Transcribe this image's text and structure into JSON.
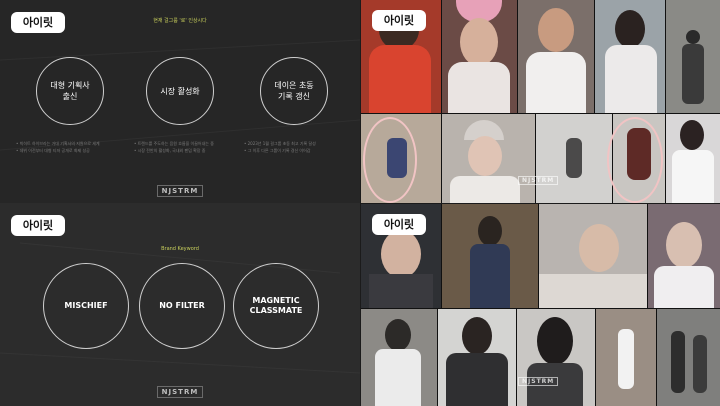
{
  "brand_logo": "아이릿",
  "watermark": "NJSTRM",
  "slide1": {
    "header": "현재 걸그룹 '로' 인상시다",
    "circles": [
      "대형 기획사\n출신",
      "시장 활성화",
      "데이은 초동\n기록 갱신"
    ],
    "notes": [
      [
        "• 빅히트 하이브라는 거대 기획사의 지원으로 세계",
        "• 데뷔 이전부터 대형 티저 공개로 화제 성공"
      ],
      [
        "• 트렌드를 주도하는 음원 흐름을 이끌어내는 중",
        "• 시장 전반의 활성화, 국내외 팬덤 확장 중"
      ],
      [
        "• 2023년 1월 걸그룹 초동 최고 기록 달성",
        "• 그 이후 다른 그룹이 기록 경신 이어감"
      ]
    ]
  },
  "slide2": {
    "header": "Brand Keyword",
    "circles": [
      "MISCHIEF",
      "NO FILTER",
      "MAGNETIC\nCLASSMATE"
    ]
  },
  "colors": {
    "accent": "#c9d05c",
    "logo_bg": "#ffffff",
    "ring": "#f1c4c4"
  }
}
